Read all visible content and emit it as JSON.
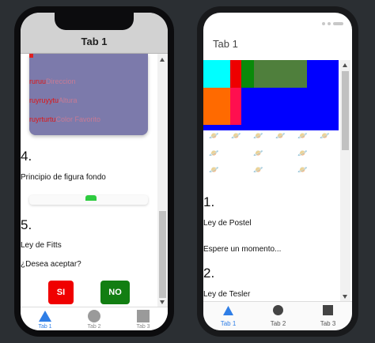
{
  "left": {
    "header_title": "Tab 1",
    "card_rows": [
      {
        "red": "ruruu",
        "label": "Direccion"
      },
      {
        "red": "ruyruyytu",
        "label": "Altura"
      },
      {
        "red": "ruyrturtu",
        "label": "Color Favorito"
      }
    ],
    "sections": [
      {
        "number": "4.",
        "title": "Principio de figura fondo"
      },
      {
        "number": "5.",
        "title": "Ley de Fitts"
      }
    ],
    "question": "¿Desea aceptar?",
    "yes_label": "SI",
    "no_label": "NO",
    "tabs": [
      "Tab 1",
      "Tab 2",
      "Tab 3"
    ],
    "colors": {
      "yes": "#f00000",
      "no": "#127e12",
      "card": "#7c7aab",
      "accent": "#2f7ee6"
    }
  },
  "right": {
    "header_title": "Tab 1",
    "sections": [
      {
        "number": "1.",
        "title": "Ley de Postel",
        "body": "Espere un momento..."
      },
      {
        "number": "2.",
        "title": "Ley de Tesler"
      }
    ],
    "tabs": [
      "Tab 1",
      "Tab 2",
      "Tab 3"
    ],
    "icon_name": "saturn-icon",
    "colors": {
      "accent": "#2f7ee6",
      "figure_bg": "#0000ff"
    }
  }
}
